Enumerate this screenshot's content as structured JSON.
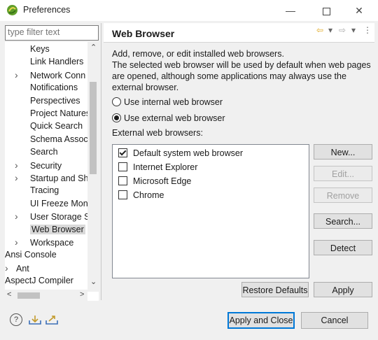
{
  "window": {
    "title": "Preferences"
  },
  "filter": {
    "placeholder": "type filter text"
  },
  "tree": {
    "items": [
      {
        "label": "Keys",
        "chev": ""
      },
      {
        "label": "Link Handlers",
        "chev": ""
      },
      {
        "label": "Network Conn",
        "chev": ">"
      },
      {
        "label": "Notifications",
        "chev": ""
      },
      {
        "label": "Perspectives",
        "chev": ""
      },
      {
        "label": "Project Natures",
        "chev": ""
      },
      {
        "label": "Quick Search",
        "chev": ""
      },
      {
        "label": "Schema Associ",
        "chev": ""
      },
      {
        "label": "Search",
        "chev": ""
      },
      {
        "label": "Security",
        "chev": ">"
      },
      {
        "label": "Startup and Sh",
        "chev": ">"
      },
      {
        "label": "Tracing",
        "chev": ""
      },
      {
        "label": "UI Freeze Mon",
        "chev": ""
      },
      {
        "label": "User Storage S",
        "chev": ">"
      },
      {
        "label": "Web Browser",
        "chev": "",
        "selected": true
      },
      {
        "label": "Workspace",
        "chev": ">"
      },
      {
        "label": "Ansi Console",
        "chev": "",
        "root": true
      },
      {
        "label": "Ant",
        "chev": ">",
        "root": true
      },
      {
        "label": "AspectJ Compiler",
        "chev": "",
        "root": true
      }
    ]
  },
  "page": {
    "title": "Web Browser",
    "description": [
      "Add, remove, or edit installed web browsers.",
      "The selected web browser will be used by default when web pages",
      "are opened, although some applications may always use the",
      "external browser."
    ],
    "radio_internal": "Use internal web browser",
    "radio_external": "Use external web browser",
    "radio_selected": "external",
    "list_label": "External web browsers:",
    "browsers": [
      {
        "label": "Default system web browser",
        "checked": true
      },
      {
        "label": "Internet Explorer",
        "checked": false
      },
      {
        "label": "Microsoft Edge",
        "checked": false
      },
      {
        "label": "Chrome",
        "checked": false
      }
    ]
  },
  "buttons": {
    "new": "New...",
    "edit": "Edit...",
    "remove": "Remove",
    "search": "Search...",
    "detect": "Detect",
    "restore_defaults": "Restore Defaults",
    "apply": "Apply",
    "apply_and_close": "Apply and Close",
    "cancel": "Cancel"
  },
  "colors": {
    "accent": "#0078d7",
    "selection": "#d9d9d9",
    "logo": "#6aa82e"
  }
}
